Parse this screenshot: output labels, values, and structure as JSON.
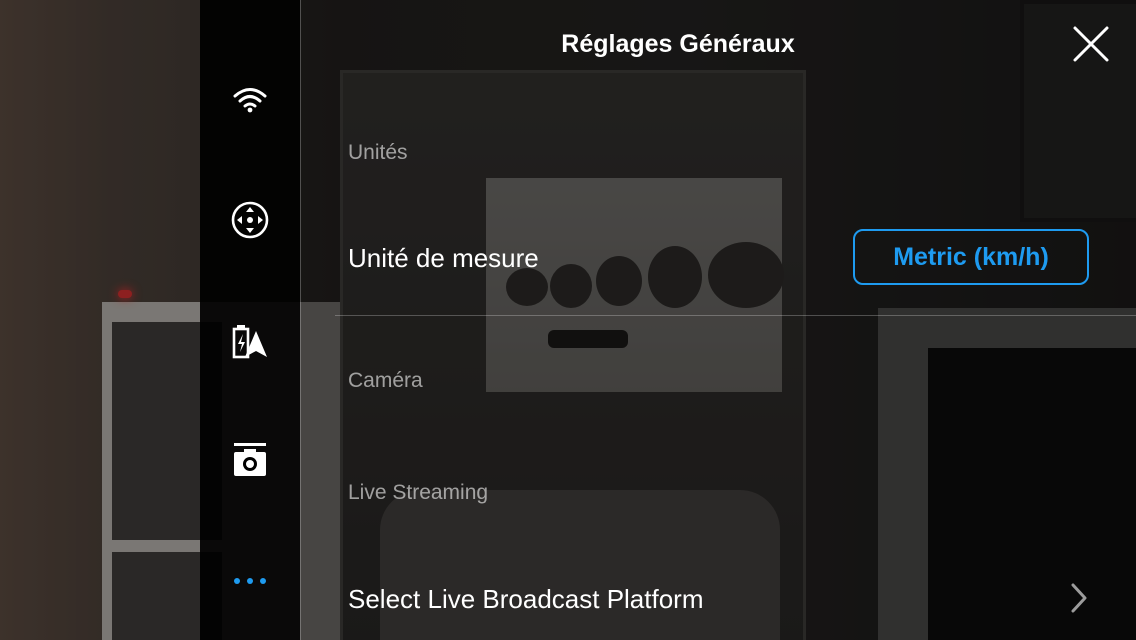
{
  "header": {
    "title": "Réglages Généraux"
  },
  "sidebar": {
    "items": [
      {
        "name": "wifi-icon"
      },
      {
        "name": "control-icon"
      },
      {
        "name": "battery-aircraft-icon"
      },
      {
        "name": "camera-icon"
      },
      {
        "name": "more-icon",
        "active": true
      }
    ]
  },
  "sections": {
    "units": {
      "title": "Unités",
      "measure_label": "Unité de mesure",
      "measure_value": "Metric (km/h)"
    },
    "camera": {
      "title": "Caméra"
    },
    "live": {
      "title": "Live Streaming",
      "platform_label": "Select Live Broadcast Platform"
    }
  },
  "colors": {
    "accent": "#1e9bf0"
  }
}
